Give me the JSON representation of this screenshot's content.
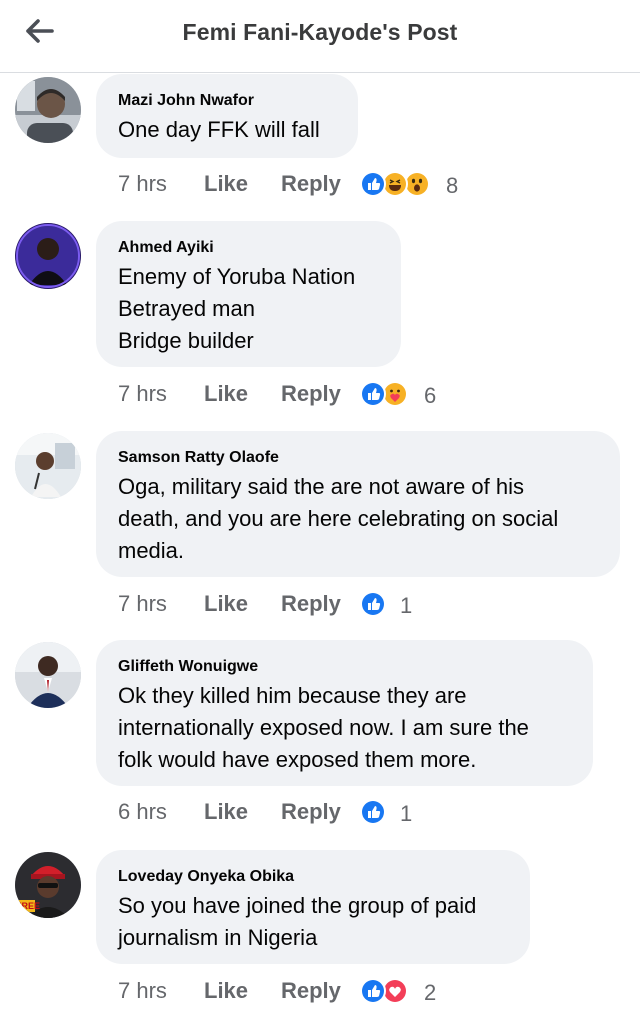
{
  "header": {
    "title": "Femi Fani-Kayode's Post",
    "back_icon": "arrow-left-icon"
  },
  "comments": [
    {
      "author": "Mazi John Nwafor",
      "text": "One day FFK will fall",
      "time": "7 hrs",
      "like": "Like",
      "reply": "Reply",
      "reactions": [
        "like",
        "haha",
        "wow"
      ],
      "reaction_count": "8"
    },
    {
      "author": "Ahmed Ayiki",
      "text": "Enemy of Yoruba Nation\nBetrayed man\nBridge builder",
      "time": "7 hrs",
      "like": "Like",
      "reply": "Reply",
      "reactions": [
        "like",
        "care"
      ],
      "reaction_count": "6"
    },
    {
      "author": "Samson Ratty Olaofe",
      "text": "Oga, military said the are not aware of his\ndeath, and you are here celebrating on social\nmedia.",
      "time": "7 hrs",
      "like": "Like",
      "reply": "Reply",
      "reactions": [
        "like"
      ],
      "reaction_count": "1"
    },
    {
      "author": "Gliffeth Wonuigwe",
      "text": "Ok they killed him because they are\ninternationally exposed now. I am sure the\nfolk would have exposed them more.",
      "time": "6 hrs",
      "like": "Like",
      "reply": "Reply",
      "reactions": [
        "like"
      ],
      "reaction_count": "1"
    },
    {
      "author": "Loveday Onyeka Obika",
      "text": "So you have joined the group of paid\njournalism in Nigeria",
      "time": "7 hrs",
      "like": "Like",
      "reply": "Reply",
      "reactions": [
        "like",
        "love"
      ],
      "reaction_count": "2"
    }
  ],
  "avatar_badge_text": "FREE",
  "colors": {
    "like_blue": "#1877f2",
    "love_red": "#f33e58",
    "emoji_yellow": "#f7b125",
    "bubble_bg": "#f0f2f5",
    "meta_gray": "#65676b"
  }
}
